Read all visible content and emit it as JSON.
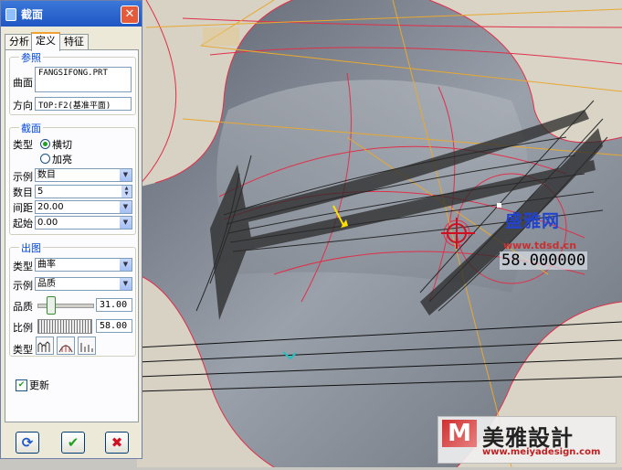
{
  "dialog": {
    "title": "截面",
    "tabs": [
      "分析",
      "定义",
      "特征"
    ],
    "reference": {
      "title": "参照",
      "surface_label": "曲面",
      "surface_value": "FANGSIFONG.PRT",
      "direction_label": "方向",
      "direction_value": "TOP:F2(基准平面)"
    },
    "section": {
      "title": "截面",
      "type_label": "类型",
      "type_options": [
        "横切",
        "加亮"
      ],
      "type_selected": "横切",
      "instance_label": "示例",
      "instance_value": "数目",
      "count_label": "数目",
      "count_value": "5",
      "spacing_label": "间距",
      "spacing_value": "20.00",
      "start_label": "起始",
      "start_value": "0.00"
    },
    "output": {
      "title": "出图",
      "type_label": "类型",
      "type_value": "曲率",
      "instance_label": "示例",
      "instance_value": "品质",
      "quality_label": "品质",
      "quality_value": "31.00",
      "quality_level": 0.31,
      "scale_label": "比例",
      "scale_value": "58.00",
      "style_label": "类型"
    },
    "update_label": "更新",
    "update_checked": true
  },
  "viewport": {
    "readout": "58.000000",
    "watermark_text": "盛雅网",
    "watermark_url": "www.tdsd.cn",
    "logo_text": "美雅設計",
    "logo_url": "www.meiyadesign.com"
  },
  "colors": {
    "curve": "#e0304a",
    "datum": "#e8a830",
    "accent": "#1f56c4"
  }
}
